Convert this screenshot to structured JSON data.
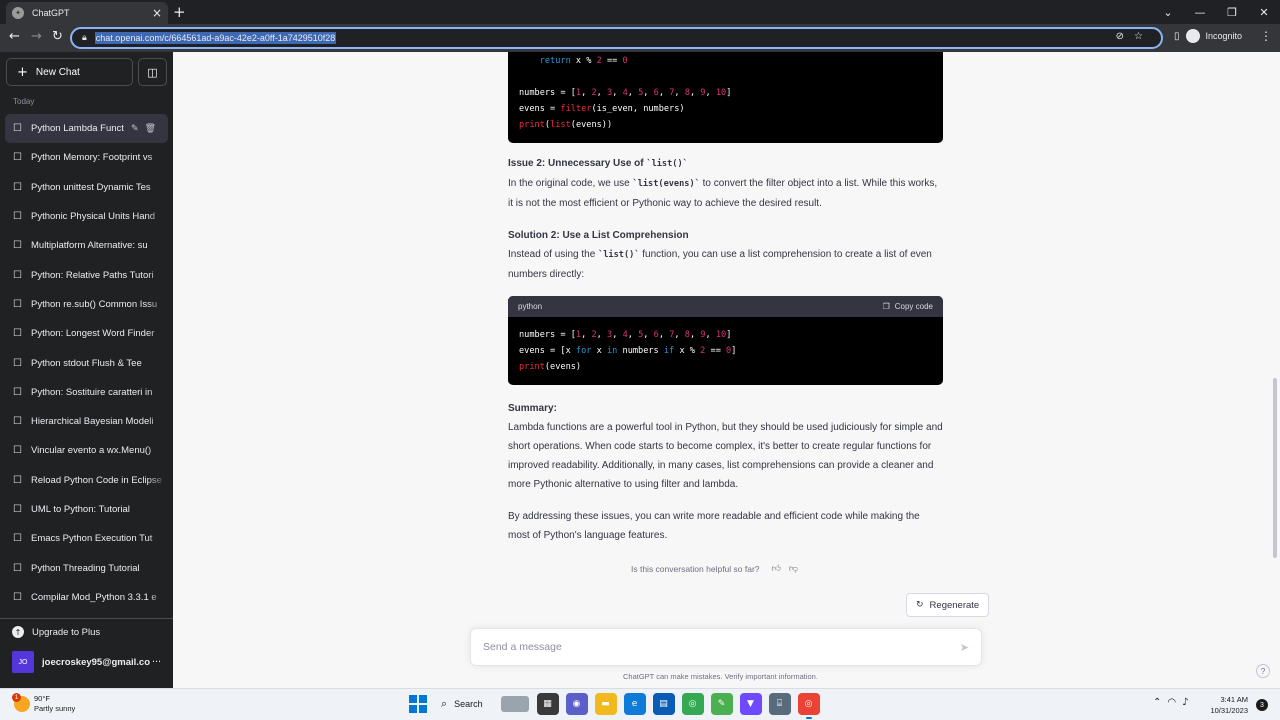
{
  "browser": {
    "tab_title": "ChatGPT",
    "url": "chat.openai.com/c/664561ad-a9ac-42e2-a0ff-1a7429510f28",
    "incognito_label": "Incognito"
  },
  "sidebar": {
    "new_chat_label": "New Chat",
    "section_label": "Today",
    "items": [
      "Python Lambda Funct",
      "Python Memory: Footprint vs",
      "Python unittest Dynamic Tes",
      "Pythonic Physical Units Hand",
      "Multiplatform Alternative: su",
      "Python: Relative Paths Tutori",
      "Python re.sub() Common Issu",
      "Python: Longest Word Finder",
      "Python stdout Flush & Tee",
      "Python: Sostituire caratteri in",
      "Hierarchical Bayesian Modeli",
      "Vincular evento a wx.Menu()",
      "Reload Python Code in Eclipse",
      "UML to Python: Tutorial",
      "Emacs Python Execution Tut",
      "Python Threading Tutorial",
      "Compilar Mod_Python 3.3.1 e"
    ],
    "upgrade_label": "Upgrade to Plus",
    "user": {
      "initials": "JO",
      "email": "joecroskey95@gmail.co"
    }
  },
  "conversation": {
    "code1_lines": [
      "    return x % 2 == 0",
      "",
      "numbers = [1, 2, 3, 4, 5, 6, 7, 8, 9, 10]",
      "evens = filter(is_even, numbers)",
      "print(list(evens))"
    ],
    "issue2_heading_prefix": "Issue 2: Unnecessary Use of ",
    "issue2_heading_code": "`list()`",
    "issue2_text_a": "In the original code, we use ",
    "issue2_text_code": "`list(evens)`",
    "issue2_text_b": " to convert the filter object into a list. While this works, it is not the most efficient or Pythonic way to achieve the desired result.",
    "solution2_heading": "Solution 2: Use a List Comprehension",
    "solution2_text_a": "Instead of using the ",
    "solution2_text_code": "`list()`",
    "solution2_text_b": " function, you can use a list comprehension to create a list of even numbers directly:",
    "code2_language": "python",
    "copy_code_label": "Copy code",
    "code2_lines": [
      "numbers = [1, 2, 3, 4, 5, 6, 7, 8, 9, 10]",
      "evens = [x for x in numbers if x % 2 == 0]",
      "print(evens)"
    ],
    "summary_heading": "Summary:",
    "summary_text": "Lambda functions are a powerful tool in Python, but they should be used judiciously for simple and short operations. When code starts to become complex, it's better to create regular functions for improved readability. Additionally, in many cases, list comprehensions can provide a cleaner and more Pythonic alternative to using filter and lambda.",
    "closing_text": "By addressing these issues, you can write more readable and efficient code while making the most of Python's language features."
  },
  "footer": {
    "feedback_question": "Is this conversation helpful so far?",
    "regenerate_label": "Regenerate",
    "message_placeholder": "Send a message",
    "disclaimer": "ChatGPT can make mistakes. Verify important information.",
    "help_label": "?"
  },
  "taskbar": {
    "weather_temp": "90°F",
    "weather_desc": "Partly sunny",
    "weather_badge": "1",
    "search_label": "Search",
    "time": "3:41 AM",
    "date": "10/31/2023",
    "notification_count": "3"
  },
  "colors": {
    "sidebar_bg": "#202123",
    "main_bg": "#f7f7f8",
    "code_keyword": "#2e95d3",
    "code_number": "#df3079",
    "code_function": "#f22c3d"
  }
}
